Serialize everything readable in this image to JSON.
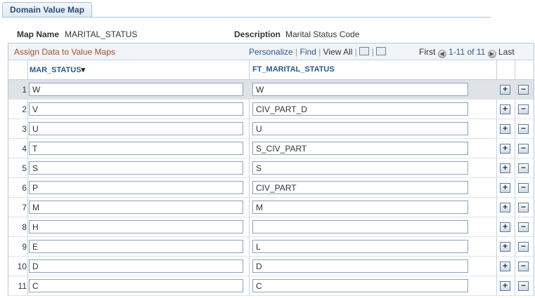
{
  "tab": {
    "label": "Domain Value Map"
  },
  "fields": {
    "map_name_label": "Map Name",
    "map_name_value": "MARITAL_STATUS",
    "description_label": "Description",
    "description_value": "Marital Status Code"
  },
  "grid": {
    "title": "Assign Data to Value Maps",
    "personalize": "Personalize",
    "find": "Find",
    "view_all": "View All",
    "first": "First",
    "range": "1-11 of 11",
    "last": "Last",
    "columns": [
      "MAR_STATUS",
      "FT_MARITAL_STATUS"
    ],
    "rows": [
      {
        "num": "1",
        "mar": "W",
        "ft": "W"
      },
      {
        "num": "2",
        "mar": "V",
        "ft": "CIV_PART_D"
      },
      {
        "num": "3",
        "mar": "U",
        "ft": "U"
      },
      {
        "num": "4",
        "mar": "T",
        "ft": "S_CIV_PART"
      },
      {
        "num": "5",
        "mar": "S",
        "ft": "S"
      },
      {
        "num": "6",
        "mar": "P",
        "ft": "CIV_PART"
      },
      {
        "num": "7",
        "mar": "M",
        "ft": "M"
      },
      {
        "num": "8",
        "mar": "H",
        "ft": ""
      },
      {
        "num": "9",
        "mar": "E",
        "ft": "L"
      },
      {
        "num": "10",
        "mar": "D",
        "ft": "D"
      },
      {
        "num": "11",
        "mar": "C",
        "ft": "C"
      }
    ]
  }
}
